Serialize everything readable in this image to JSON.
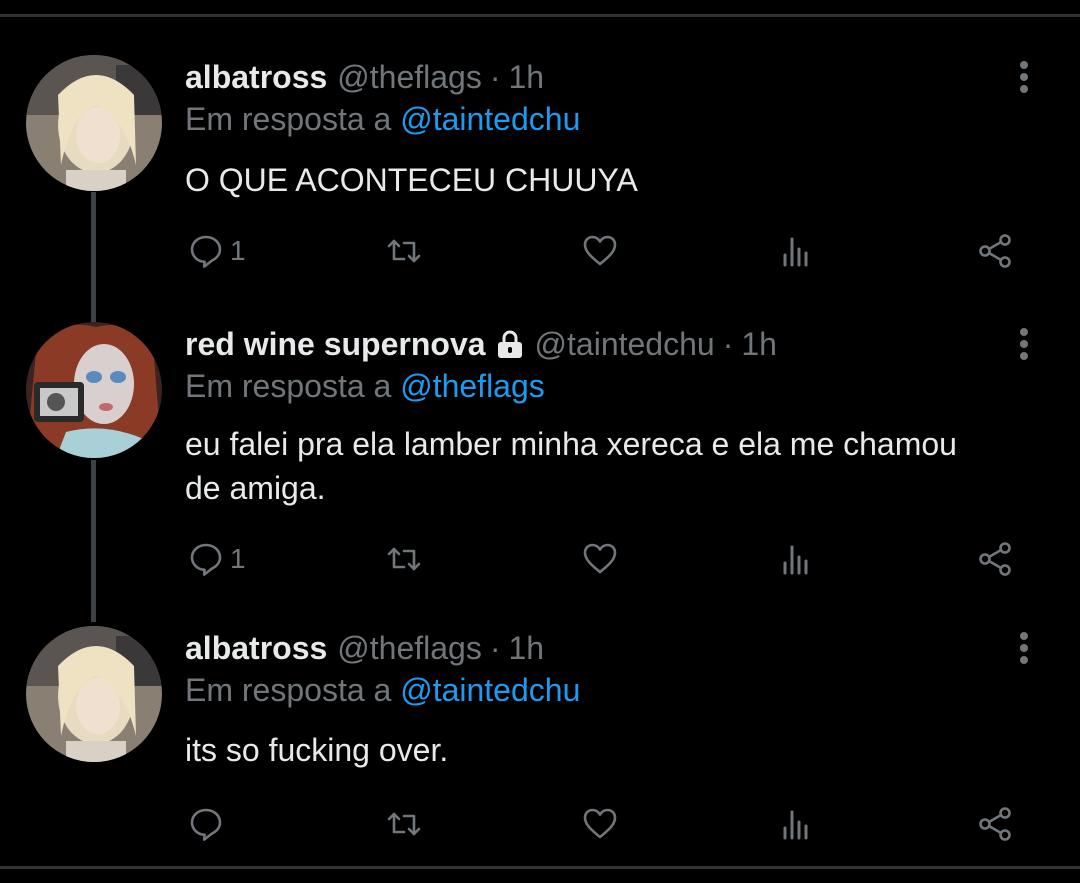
{
  "thread": [
    {
      "name": "albatross",
      "handle": "@theflags",
      "separator": "·",
      "time": "1h",
      "reply_prefix": "Em resposta a",
      "reply_mention": "@taintedchu",
      "text": "O QUE ACONTECEU CHUUYA",
      "reply_count": "1"
    },
    {
      "name": "red wine supernova",
      "handle": "@taintedchu",
      "separator": "·",
      "time": "1h",
      "reply_prefix": "Em resposta a",
      "reply_mention": "@theflags",
      "text": "eu falei pra ela lamber minha xereca e ela me chamou de amiga.",
      "reply_count": "1",
      "protected": true
    },
    {
      "name": "albatross",
      "handle": "@theflags",
      "separator": "·",
      "time": "1h",
      "reply_prefix": "Em resposta a",
      "reply_mention": "@taintedchu",
      "text": "its so fucking over.",
      "reply_count": ""
    }
  ],
  "icons": {
    "reply": "reply-icon",
    "retweet": "retweet-icon",
    "like": "heart-icon",
    "views": "analytics-icon",
    "share": "share-icon",
    "more": "more-icon",
    "lock": "lock-icon"
  },
  "colors": {
    "background": "#000000",
    "text": "#e7e9ea",
    "muted": "#71767b",
    "link": "#1d9bf0",
    "divider": "#2f3336"
  }
}
